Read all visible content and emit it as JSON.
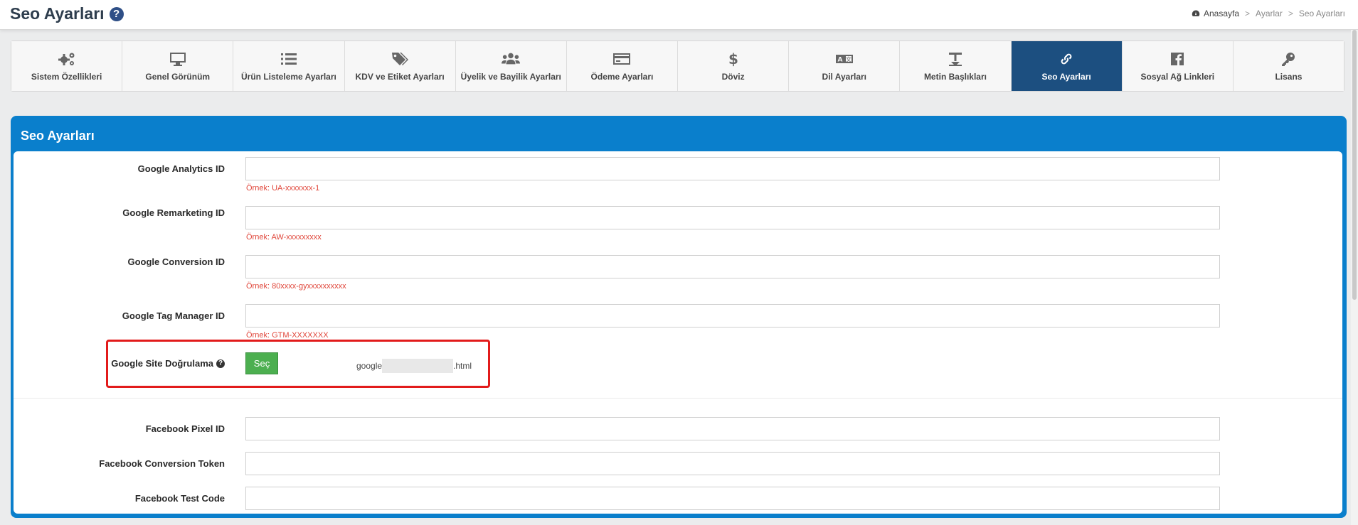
{
  "header": {
    "title": "Seo Ayarları",
    "help_icon": "question-circle-icon",
    "breadcrumb": [
      "Anasayfa",
      "Ayarlar",
      "Seo Ayarları"
    ],
    "breadcrumb_sep": ">"
  },
  "tabs": [
    {
      "label": "Sistem Özellikleri",
      "icon": "gears-icon"
    },
    {
      "label": "Genel Görünüm",
      "icon": "monitor-icon"
    },
    {
      "label": "Ürün Listeleme Ayarları",
      "icon": "list-icon"
    },
    {
      "label": "KDV ve Etiket Ayarları",
      "icon": "tags-icon"
    },
    {
      "label": "Üyelik ve Bayilik Ayarları",
      "icon": "users-icon"
    },
    {
      "label": "Ödeme Ayarları",
      "icon": "credit-card-icon"
    },
    {
      "label": "Döviz",
      "icon": "dollar-icon"
    },
    {
      "label": "Dil Ayarları",
      "icon": "language-icon"
    },
    {
      "label": "Metin Başlıkları",
      "icon": "text-height-icon"
    },
    {
      "label": "Seo Ayarları",
      "icon": "link-icon",
      "active": true
    },
    {
      "label": "Sosyal Ağ Linkleri",
      "icon": "facebook-icon"
    },
    {
      "label": "Lisans",
      "icon": "key-icon"
    }
  ],
  "panel": {
    "title": "Seo Ayarları",
    "fields": {
      "analytics": {
        "label": "Google Analytics ID",
        "value": "",
        "hint": "Örnek: UA-xxxxxxx-1"
      },
      "remarketing": {
        "label": "Google Remarketing ID",
        "value": "",
        "hint": "Örnek: AW-xxxxxxxxx"
      },
      "conversion": {
        "label": "Google Conversion ID",
        "value": "",
        "hint": "Örnek: 80xxxx-gyxxxxxxxxxx"
      },
      "tagmanager": {
        "label": "Google Tag Manager ID",
        "value": "",
        "hint": "Örnek: GTM-XXXXXXX"
      },
      "site_verify": {
        "label": "Google Site Doğrulama",
        "button": "Seç",
        "file_prefix": "google",
        "file_suffix": ".html"
      },
      "fb_pixel": {
        "label": "Facebook Pixel ID",
        "value": ""
      },
      "fb_token": {
        "label": "Facebook Conversion Token",
        "value": ""
      },
      "fb_test": {
        "label": "Facebook Test Code",
        "value": ""
      }
    }
  },
  "colors": {
    "panel_blue": "#0a7fcc",
    "active_tab": "#1c4f80",
    "button_green": "#4caf50",
    "hint_red": "#e0463a",
    "highlight_red": "#e21b1b"
  }
}
